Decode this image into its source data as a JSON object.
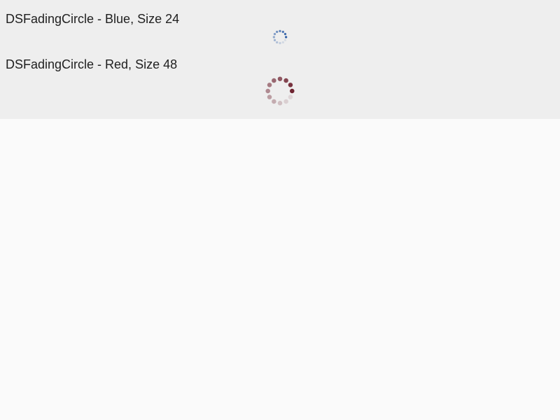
{
  "demos": [
    {
      "title": "DSFadingCircle - Blue, Size 24",
      "color": "#2f5fa8",
      "size": 24
    },
    {
      "title": "DSFadingCircle - Red, Size 48",
      "color": "#6e2330",
      "size": 48
    }
  ],
  "colors": {
    "panel_background": "#eeeeee",
    "page_background": "#fafafa",
    "text": "#1f1f1f"
  },
  "icons": {
    "spinner": "fading-circle-spinner-icon"
  }
}
